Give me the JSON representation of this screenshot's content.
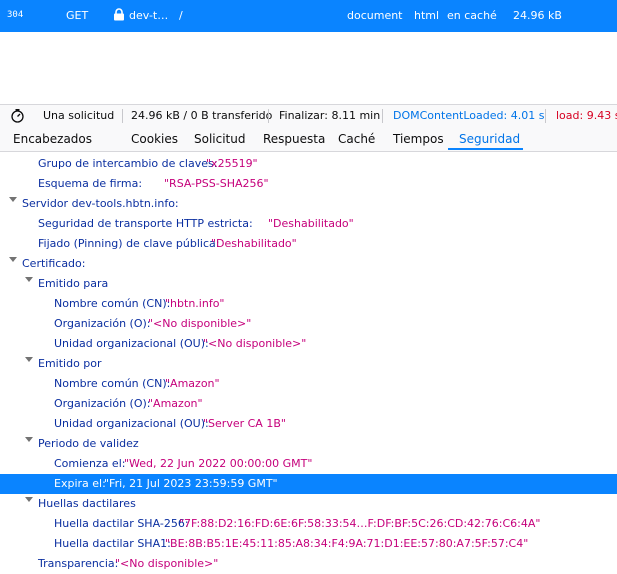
{
  "request": {
    "status": "304",
    "method": "GET",
    "file": "dev-t…",
    "path": "/",
    "type": "document",
    "content_type": "html",
    "transferred": "en caché",
    "size": "24.96 kB"
  },
  "summary": {
    "requests": "Una solicitud",
    "transferred": "24.96 kB / 0 B transferido",
    "finish": "Finalizar: 8.11 min",
    "dom_loaded": "DOMContentLoaded: 4.01 s",
    "load": "load: 9.43 s"
  },
  "tabs": [
    "Encabezados",
    "Cookies",
    "Solicitud",
    "Respuesta",
    "Caché",
    "Tiempos",
    "Seguridad"
  ],
  "security": {
    "kx_group_key": "Grupo de intercambio de claves:",
    "kx_group_val": "\"x25519\"",
    "sig_scheme_key": "Esquema de firma:",
    "sig_scheme_val": "\"RSA-PSS-SHA256\"",
    "server_key": "Servidor dev-tools.hbtn.info:",
    "hsts_key": "Seguridad de transporte HTTP estricta:",
    "hsts_val": "\"Deshabilitado\"",
    "hpkp_key": "Fijado (Pinning) de clave pública:",
    "hpkp_val": "\"Deshabilitado\"",
    "cert_key": "Certificado:",
    "issued_to_key": "Emitido para",
    "to_cn_key": "Nombre común (CN):",
    "to_cn_val": "\"hbtn.info\"",
    "to_o_key": "Organización (O):",
    "to_o_val": "\"<No disponible>\"",
    "to_ou_key": "Unidad organizacional (OU):",
    "to_ou_val": "\"<No disponible>\"",
    "issued_by_key": "Emitido por",
    "by_cn_key": "Nombre común (CN):",
    "by_cn_val": "\"Amazon\"",
    "by_o_key": "Organización (O):",
    "by_o_val": "\"Amazon\"",
    "by_ou_key": "Unidad organizacional (OU):",
    "by_ou_val": "\"Server CA 1B\"",
    "validity_key": "Periodo de validez",
    "begins_key": "Comienza el:",
    "begins_val": "\"Wed, 22 Jun 2022 00:00:00 GMT\"",
    "expires_key": "Expira el:",
    "expires_val": "\"Fri, 21 Jul 2023 23:59:59 GMT\"",
    "fingerprints_key": "Huellas dactilares",
    "sha256_key": "Huella dactilar SHA-256:",
    "sha256_val": "\"7F:88:D2:16:FD:6E:6F:58:33:54…F:DF:BF:5C:26:CD:42:76:C6:4A\"",
    "sha1_key": "Huella dactilar SHA1:",
    "sha1_val": "\"BE:8B:B5:1E:45:11:85:A8:34:F4:9A:71:D1:EE:57:80:A7:5F:57:C4\"",
    "transparency_key": "Transparencia:",
    "transparency_val": "\"<No disponible>\""
  },
  "colors": {
    "selection": "#0a84ff",
    "key": "#0b2fa0",
    "value": "#c5007b"
  }
}
